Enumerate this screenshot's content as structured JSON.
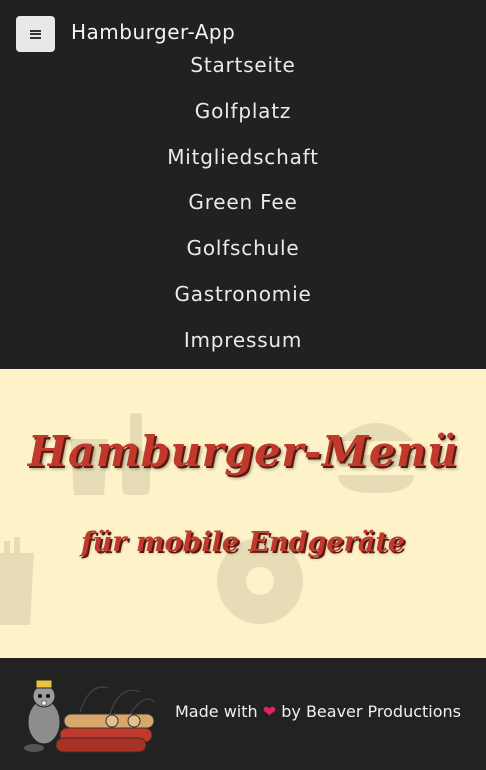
{
  "header": {
    "app_title": "Hamburger-App",
    "menu_icon": "bars-icon"
  },
  "nav": {
    "items": [
      {
        "label": "Startseite"
      },
      {
        "label": "Golfplatz"
      },
      {
        "label": "Mitgliedschaft"
      },
      {
        "label": "Green Fee"
      },
      {
        "label": "Golfschule"
      },
      {
        "label": "Gastronomie"
      },
      {
        "label": "Impressum"
      }
    ]
  },
  "hero": {
    "title": "Hamburger-Menü",
    "subtitle": "für mobile Endgeräte",
    "title_color": "#c0392b",
    "background_color": "#fdf2c8"
  },
  "footer": {
    "made_with": "Made with",
    "heart": "❤",
    "by_text": "by Beaver Productions",
    "logo_icon": "beaver-logo-icon"
  }
}
